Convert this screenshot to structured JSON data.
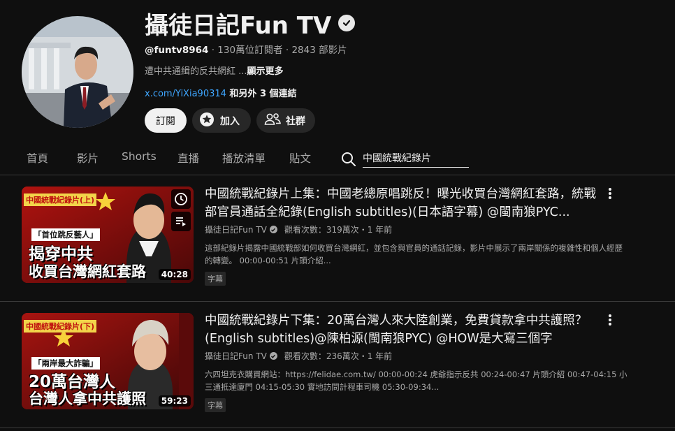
{
  "channel": {
    "name": "攝徒日記Fun TV",
    "handle": "@funtv8964",
    "subscribers": "130萬位訂閱者",
    "video_count": "2843 部影片",
    "meta_sep": " · ",
    "description": "遭中共通緝的反共網紅 ...",
    "show_more": "顯示更多",
    "link_url": "x.com/YiXia90314",
    "link_extra": " 和另外 3 個連結"
  },
  "buttons": {
    "subscribe": "訂閱",
    "join": "加入",
    "community": "社群"
  },
  "tabs": [
    "首頁",
    "影片",
    "Shorts",
    "直播",
    "播放清單",
    "貼文"
  ],
  "search": {
    "value": "中國統戰紀錄片"
  },
  "videos": [
    {
      "title": "中國統戰紀錄片上集：中國老總原唱跳反！曝光收買台灣網紅套路，統戰部官員通話全紀錄(English subtitles)(日本語字幕) @閩南狼PYC...",
      "channel": "攝徒日記Fun TV",
      "views_time": "觀看次數：319萬次・1 年前",
      "description": "這部紀錄片揭露中國統戰部如何收買台灣網紅，並包含與官員的通話記錄，影片中展示了兩岸關係的複雜性和個人經歷的轉變。 00:00-00:51 片頭介紹...",
      "badge": "字幕",
      "duration": "40:28",
      "thumb_tag": "中國統戰紀錄片(上)",
      "thumb_sub": "「首位跳反藝人」",
      "thumb_line1": "揭穿中共",
      "thumb_line2": "收買台灣網紅套路"
    },
    {
      "title": "中國統戰紀錄片下集：20萬台灣人來大陸創業，免費貸款拿中共護照？(English subtitles)@陳柏源(閩南狼PYC) @HOW是大寫三個字",
      "channel": "攝徒日記Fun TV",
      "views_time": "觀看次數：236萬次・1 年前",
      "description": "六四坦克衣購買網站：https://felidae.com.tw/ 00:00-00:24 虎爺指示反共 00:24-00:47 片頭介紹 00:47-04:15 小三通抵達廈門 04:15-05:30 實地訪問計程車司機 05:30-09:34...",
      "badge": "字幕",
      "duration": "59:23",
      "thumb_tag": "中國統戰紀錄片(下)",
      "thumb_sub": "「兩岸最大詐騙」",
      "thumb_line1": "20萬台灣人",
      "thumb_line2": "台灣人拿中共護照"
    }
  ],
  "icons": {
    "verified": "verified-check-icon",
    "join": "star-icon",
    "community": "people-icon",
    "search": "search-icon",
    "watch_later": "clock-icon",
    "add_queue": "queue-icon",
    "menu": "more-vert-icon"
  },
  "colors": {
    "background": "#0f0f0f",
    "link": "#3ea6ff",
    "button_dark": "#272727"
  }
}
